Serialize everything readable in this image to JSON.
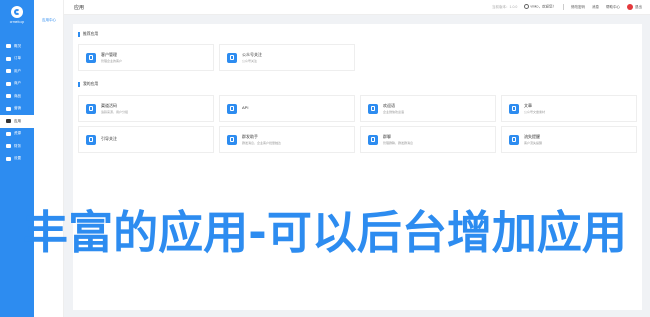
{
  "brand": {
    "name": "crmeb.cp"
  },
  "sidebar": {
    "items": [
      {
        "label": "概况",
        "icon": "home-icon",
        "active": false
      },
      {
        "label": "订单",
        "icon": "order-icon",
        "active": false
      },
      {
        "label": "用户",
        "icon": "users-icon",
        "active": false
      },
      {
        "label": "商户",
        "icon": "merchant-icon",
        "active": false
      },
      {
        "label": "商品",
        "icon": "bag-icon",
        "active": false
      },
      {
        "label": "营销",
        "icon": "marketing-icon",
        "active": false
      },
      {
        "label": "应用",
        "icon": "grid-icon",
        "active": true
      },
      {
        "label": "资源",
        "icon": "resource-icon",
        "active": false
      },
      {
        "label": "财务",
        "icon": "finance-icon",
        "active": false
      },
      {
        "label": "设置",
        "icon": "gear-icon",
        "active": false
      }
    ]
  },
  "subsidebar": {
    "item": "应用中心"
  },
  "topbar": {
    "title": "应用",
    "hint": "当前版本：1.0.0",
    "location": "vinko，欢迎您！",
    "links": [
      "修改密码",
      "消息",
      "帮助中心"
    ],
    "logout": "退出"
  },
  "sections": {
    "featured": {
      "title": "推荐应用",
      "cards": [
        {
          "title": "客户管理",
          "desc": "管理企业的客户"
        },
        {
          "title": "公众号关注",
          "desc": "公众号关注"
        }
      ]
    },
    "mine": {
      "title": "我的应用",
      "cards": [
        {
          "title": "渠道活码",
          "desc": "追踪来源，用户分组"
        },
        {
          "title": "API",
          "desc": ""
        },
        {
          "title": "欢迎语",
          "desc": "企业微信欢迎语"
        },
        {
          "title": "文章",
          "desc": "公众号文章素材"
        },
        {
          "title": "引导关注",
          "desc": ""
        },
        {
          "title": "群发助手",
          "desc": "群发消息，企业客户批量触达"
        },
        {
          "title": "群聊",
          "desc": "管理群聊，群发群消息"
        },
        {
          "title": "流失提醒",
          "desc": "客户流失提醒"
        }
      ]
    }
  },
  "banner": {
    "text": "丰富的应用-可以后台增加应用"
  },
  "colors": {
    "primary": "#2d8cf0",
    "sidebar": "#2d8cf0",
    "background": "#f0f2f5",
    "logout_avatar": "#e4393c"
  }
}
